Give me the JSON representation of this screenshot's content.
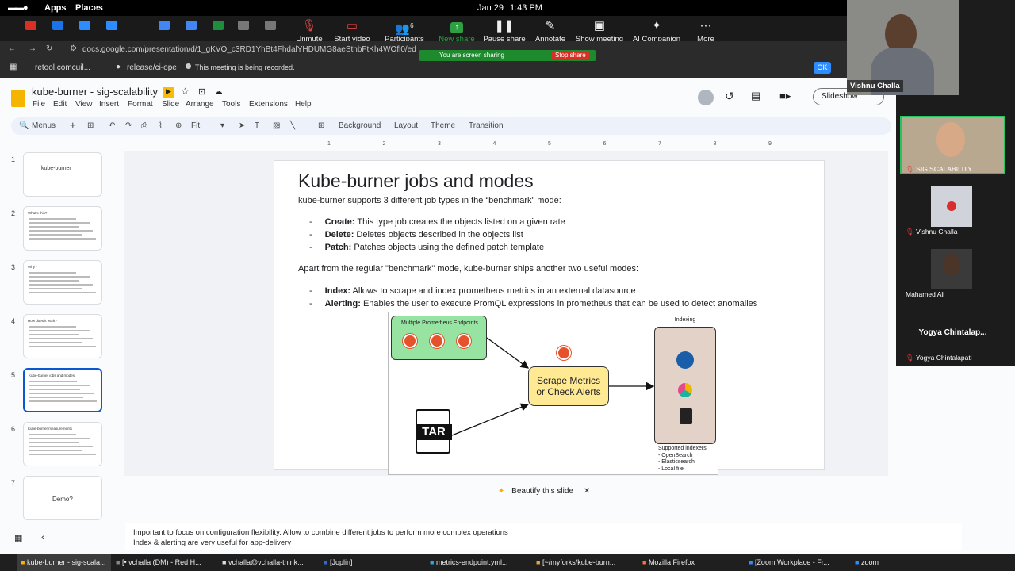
{
  "gnome": {
    "apps": "Apps",
    "places": "Places",
    "date": "Jan 29",
    "time": "1:43 PM"
  },
  "zoom": {
    "unmute": "Unmute",
    "start_video": "Start video",
    "participants": "Participants",
    "participants_count": "6",
    "new_share": "New share",
    "pause_share": "Pause share",
    "annotate": "Annotate",
    "show_meeting": "Show meeting",
    "ai": "AI Companion",
    "more": "More",
    "sharing": "You are screen sharing",
    "stop_share": "Stop share",
    "recorded": "This meeting is being recorded.",
    "ok": "OK"
  },
  "browser": {
    "url": "docs.google.com/presentation/d/1_gKVO_c3RD1YhBt4FhdalYHDUMG8aeSthbFtKh4WOfl0/edit?slide=",
    "bm1": "retool.comcuil...",
    "bm2": "release/ci-ope"
  },
  "docs": {
    "title": "kube-burner - sig-scalability",
    "menus": [
      "File",
      "Edit",
      "View",
      "Insert",
      "Format",
      "Slide",
      "Arrange",
      "Tools",
      "Extensions",
      "Help"
    ],
    "slideshow": "Slideshow",
    "menus_search": "Menus",
    "zoom": "Fit",
    "background": "Background",
    "layout": "Layout",
    "theme": "Theme",
    "transition": "Transition",
    "beautify": "Beautify this slide"
  },
  "ruler": [
    "1",
    "2",
    "3",
    "4",
    "5",
    "6",
    "7",
    "8",
    "9"
  ],
  "thumbs": [
    {
      "n": "1",
      "title": "kube-burner"
    },
    {
      "n": "2",
      "title": "What's this?"
    },
    {
      "n": "3",
      "title": "Why?"
    },
    {
      "n": "4",
      "title": "How does it work?"
    },
    {
      "n": "5",
      "title": "Kube-burner jobs and modes"
    },
    {
      "n": "6",
      "title": "Kube-burner measurements"
    },
    {
      "n": "7",
      "title": "Demo?"
    }
  ],
  "slide": {
    "title": "Kube-burner jobs and modes",
    "intro": "kube-burner supports 3 different job types in the “benchmark” mode:",
    "jobs": [
      {
        "k": "Create:",
        "v": " This type job creates the objects listed on a given rate"
      },
      {
        "k": "Delete:",
        "v": " Deletes objects described in the objects list"
      },
      {
        "k": "Patch:",
        "v": " Patches objects using the defined patch template"
      }
    ],
    "apart": "Apart from the regular \"benchmark\" mode, kube-burner ships another two useful modes:",
    "modes": [
      {
        "k": "Index:",
        "v": " Allows to scrape and index prometheus metrics in an external datasource"
      },
      {
        "k": "Alerting:",
        "v": " Enables the user to execute PromQL expressions in prometheus that can be used to detect anomalies"
      }
    ],
    "diagram": {
      "endpoints": "Multiple Prometheus Endpoints",
      "scrape1": "Scrape Metrics",
      "scrape2": "or Check Alerts",
      "indexing": "Indexing",
      "tar": "TAR",
      "supported": "Supported indexers",
      "idx": [
        "- OpenSearch",
        "- Elasticsearch",
        "- Local file"
      ]
    }
  },
  "notes": {
    "l1": "Important to focus on configuration flexibility. Allow to combine different jobs to perform more complex operations",
    "l2": "Index & alerting are very useful for app-delivery"
  },
  "video": {
    "speaker": "Vishnu Challa",
    "t1": "SIG SCALABILITY",
    "t2": "Vishnu Challa",
    "t3": "Mahamed Ali",
    "t4big": "Yogya Chintalap...",
    "t4": "Yogya Chintalapati"
  },
  "taskbar": [
    "kube-burner - sig-scala...",
    "[• vchalla (DM) - Red H...",
    "vchalla@vchalla-think...",
    "[Joplin]",
    "metrics-endpoint.yml...",
    "[~/myforks/kube-burn...",
    "Mozilla Firefox",
    "[Zoom Workplace - Fr...",
    "zoom"
  ]
}
